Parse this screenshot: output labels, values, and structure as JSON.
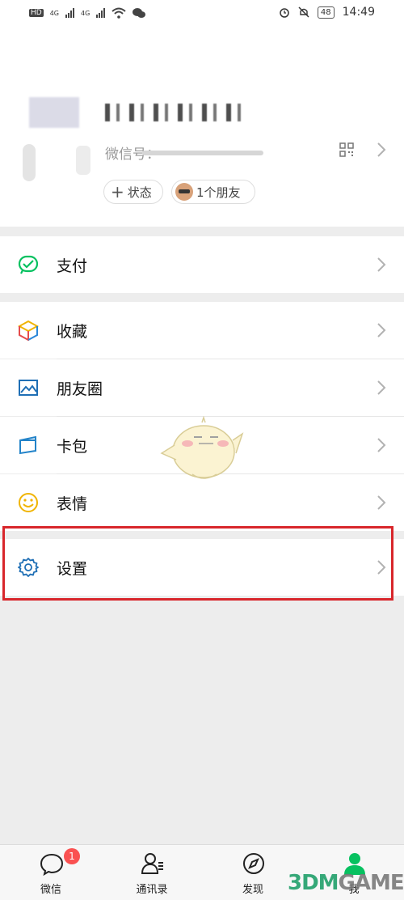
{
  "status_bar": {
    "left_items": [
      "HD",
      "4G",
      "4G"
    ],
    "battery": "48",
    "time": "14:49"
  },
  "profile": {
    "wechat_id_prefix": "微信号：",
    "status_button": "状态",
    "friends_button": "1个朋友"
  },
  "menu": {
    "pay": "支付",
    "favorites": "收藏",
    "moments": "朋友圈",
    "cards": "卡包",
    "stickers": "表情",
    "settings": "设置"
  },
  "tabs": [
    {
      "label": "微信",
      "badge": "1"
    },
    {
      "label": "通讯录"
    },
    {
      "label": "发现"
    },
    {
      "label": "我"
    }
  ],
  "watermark": {
    "part1": "3DM",
    "part2": "GAME"
  },
  "colors": {
    "wechat_green": "#07c160",
    "highlight_red": "#d8262b",
    "badge_red": "#fa5151"
  }
}
